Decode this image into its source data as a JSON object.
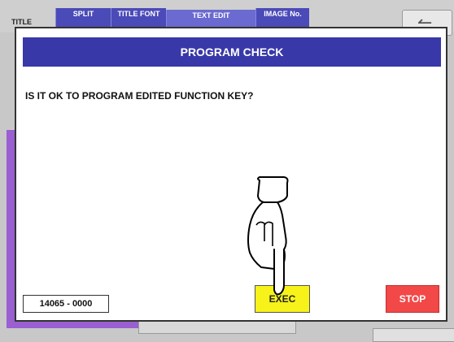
{
  "background": {
    "title_label": "TITLE",
    "tabs": [
      {
        "label": "SPLIT"
      },
      {
        "label": "TITLE FONT"
      },
      {
        "label": "TEXT EDIT"
      },
      {
        "label": "IMAGE No."
      }
    ],
    "icon": "left-arrow-icon"
  },
  "dialog": {
    "title": "PROGRAM CHECK",
    "message": "IS IT OK TO PROGRAM EDITED FUNCTION KEY?",
    "code": "14065 - 0000",
    "exec_label": "EXEC",
    "stop_label": "STOP",
    "pointer_icon": "hand-pointer-icon"
  },
  "colors": {
    "header": "#3838a8",
    "exec": "#f6f21a",
    "stop": "#f24848",
    "accent_purple": "#9a5fd0"
  }
}
